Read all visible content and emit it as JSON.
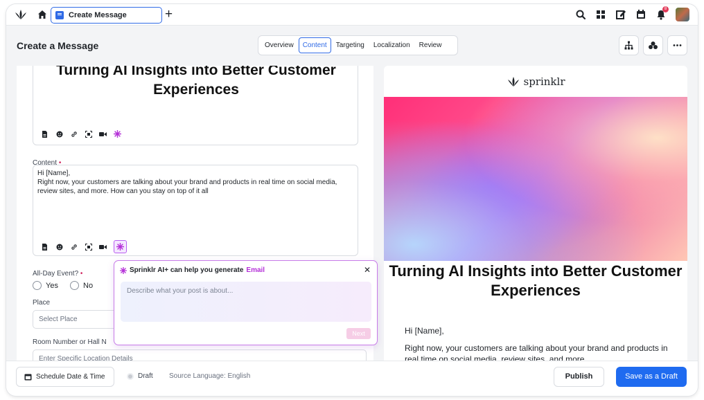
{
  "topbar": {
    "active_tab_label": "Create Message",
    "icons": [
      "sprinklr-logo-icon",
      "home-icon",
      "message-icon",
      "plus-icon",
      "search-icon",
      "grid-icon",
      "edit-icon",
      "calendar-icon",
      "bell-icon",
      "avatar"
    ],
    "notification_count": "8"
  },
  "header": {
    "title": "Create a Message",
    "tabs": [
      {
        "label": "Overview",
        "active": false
      },
      {
        "label": "Content",
        "active": true
      },
      {
        "label": "Targeting",
        "active": false
      },
      {
        "label": "Localization",
        "active": false
      },
      {
        "label": "Review",
        "active": false
      }
    ],
    "actions": [
      "hierarchy-icon",
      "group-icon",
      "more-icon"
    ]
  },
  "form": {
    "hero_text": "Turning AI Insights into Better Customer Experiences",
    "content_label": "Content",
    "content_lines": [
      "Hi [Name],",
      "Right now, your customers are talking about your brand and products in real time on social media, review sites, and more. How can you stay on top of it all"
    ],
    "all_day_label": "All-Day Event?",
    "radio_yes": "Yes",
    "radio_no": "No",
    "place_label": "Place",
    "place_placeholder": "Select Place",
    "room_label": "Room Number or Hall N",
    "room_placeholder": "Enter Specific Location Details"
  },
  "ai_popup": {
    "title": "Sprinklr AI+ can help you generate",
    "title_accent": "Email",
    "input_placeholder": "Describe what your post is about...",
    "next_label": "Next",
    "accent_color": "#b430d8"
  },
  "preview": {
    "brand": "sprinklr",
    "title": "Turning AI Insights into Better Customer Experiences",
    "greeting": "Hi [Name],",
    "body": "Right now, your customers are talking about your brand and products in real time on social media, review sites, and more."
  },
  "footer": {
    "schedule_label": "Schedule Date & Time",
    "status": "Draft",
    "source_language": "Source Language: English",
    "publish_label": "Publish",
    "save_draft_label": "Save as a Draft",
    "primary_color": "#1f6bf0"
  }
}
